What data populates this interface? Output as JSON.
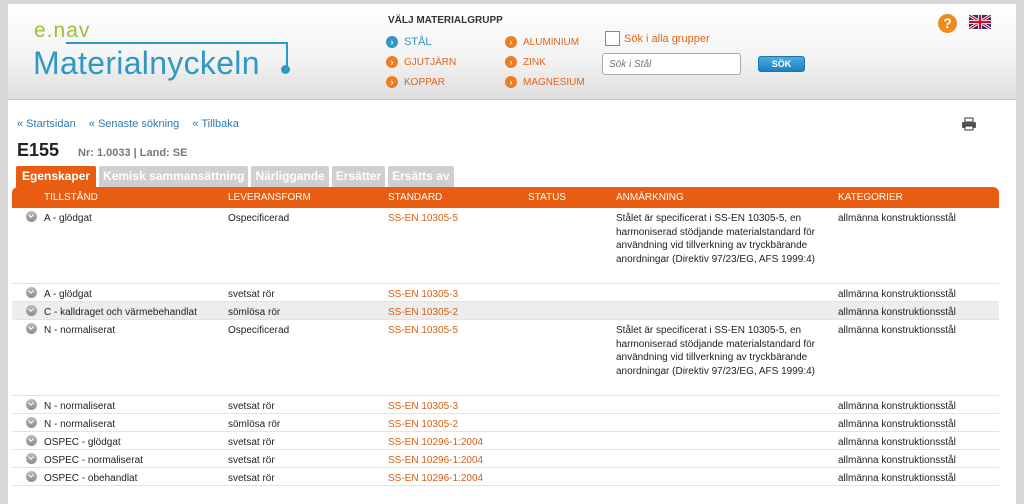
{
  "header": {
    "logo_small": "e.nav",
    "logo_main": "Materialnyckeln",
    "group_title": "VÄLJ MATERIALGRUPP",
    "groups": [
      {
        "label": "STÅL",
        "active": true
      },
      {
        "label": "GJUTJÄRN",
        "active": false
      },
      {
        "label": "KOPPAR",
        "active": false
      },
      {
        "label": "ALUMINIUM",
        "active": false
      },
      {
        "label": "ZINK",
        "active": false
      },
      {
        "label": "MAGNESIUM",
        "active": false
      }
    ],
    "search_all_label": "Sök i alla grupper",
    "search_all_checked": false,
    "search_placeholder": "Sök i Stål",
    "search_button": "SÖK",
    "help_icon": "question-icon",
    "language_icon": "uk-flag-icon"
  },
  "nav": {
    "breadcrumbs": [
      "« Startsidan",
      "« Senaste sökning",
      "« Tillbaka"
    ],
    "print_icon": "printer-icon"
  },
  "material": {
    "code": "E155",
    "meta": "Nr: 1.0033 | Land: SE"
  },
  "tabs": [
    {
      "label": "Egenskaper",
      "active": true
    },
    {
      "label": "Kemisk sammansättning",
      "active": false
    },
    {
      "label": "Närliggande",
      "active": false
    },
    {
      "label": "Ersätter",
      "active": false
    },
    {
      "label": "Ersätts av",
      "active": false
    }
  ],
  "table": {
    "columns": [
      "TILLSTÅND",
      "LEVERANSFORM",
      "STANDARD",
      "STATUS",
      "ANMÄRKNING",
      "KATEGORIER"
    ],
    "rows": [
      {
        "tillstand": "A - glödgat",
        "leveransform": "Ospecificerad",
        "standard": "SS-EN 10305-5",
        "status": "",
        "anmarkning": "Stålet är specificerat i SS-EN 10305-5, en harmoniserad stödjande materialstandard för användning vid tillverkning av tryckbärande anordningar (Direktiv 97/23/EG, AFS 1999:4)",
        "kategorier": "allmänna konstruktionsstål",
        "shaded": false
      },
      {
        "tillstand": "A - glödgat",
        "leveransform": "svetsat rör",
        "standard": "SS-EN 10305-3",
        "status": "",
        "anmarkning": "",
        "kategorier": "allmänna konstruktionsstål",
        "shaded": false
      },
      {
        "tillstand": "C - kalldraget och värmebehandlat",
        "leveransform": "sömlösa rör",
        "standard": "SS-EN 10305-2",
        "status": "",
        "anmarkning": "",
        "kategorier": "allmänna konstruktionsstål",
        "shaded": true
      },
      {
        "tillstand": "N - normaliserat",
        "leveransform": "Ospecificerad",
        "standard": "SS-EN 10305-5",
        "status": "",
        "anmarkning": "Stålet är specificerat i SS-EN 10305-5, en harmoniserad stödjande materialstandard för användning vid tillverkning av tryckbärande anordningar (Direktiv 97/23/EG, AFS 1999:4)",
        "kategorier": "allmänna konstruktionsstål",
        "shaded": false
      },
      {
        "tillstand": "N - normaliserat",
        "leveransform": "svetsat rör",
        "standard": "SS-EN 10305-3",
        "status": "",
        "anmarkning": "",
        "kategorier": "allmänna konstruktionsstål",
        "shaded": false
      },
      {
        "tillstand": "N - normaliserat",
        "leveransform": "sömlösa rör",
        "standard": "SS-EN 10305-2",
        "status": "",
        "anmarkning": "",
        "kategorier": "allmänna konstruktionsstål",
        "shaded": false
      },
      {
        "tillstand": "OSPEC - glödgat",
        "leveransform": "svetsat rör",
        "standard": "SS-EN 10296-1:2004",
        "status": "",
        "anmarkning": "",
        "kategorier": "allmänna konstruktionsstål",
        "shaded": false
      },
      {
        "tillstand": "OSPEC - normaliserat",
        "leveransform": "svetsat rör",
        "standard": "SS-EN 10296-1:2004",
        "status": "",
        "anmarkning": "",
        "kategorier": "allmänna konstruktionsstål",
        "shaded": false
      },
      {
        "tillstand": "OSPEC - obehandlat",
        "leveransform": "svetsat rör",
        "standard": "SS-EN 10296-1:2004",
        "status": "",
        "anmarkning": "",
        "kategorier": "allmänna konstruktionsstål",
        "shaded": false
      }
    ]
  },
  "colors": {
    "accent": "#e95d12",
    "brand_blue": "#2f98c4",
    "brand_green": "#9bc13c",
    "link": "#2f79b0"
  }
}
